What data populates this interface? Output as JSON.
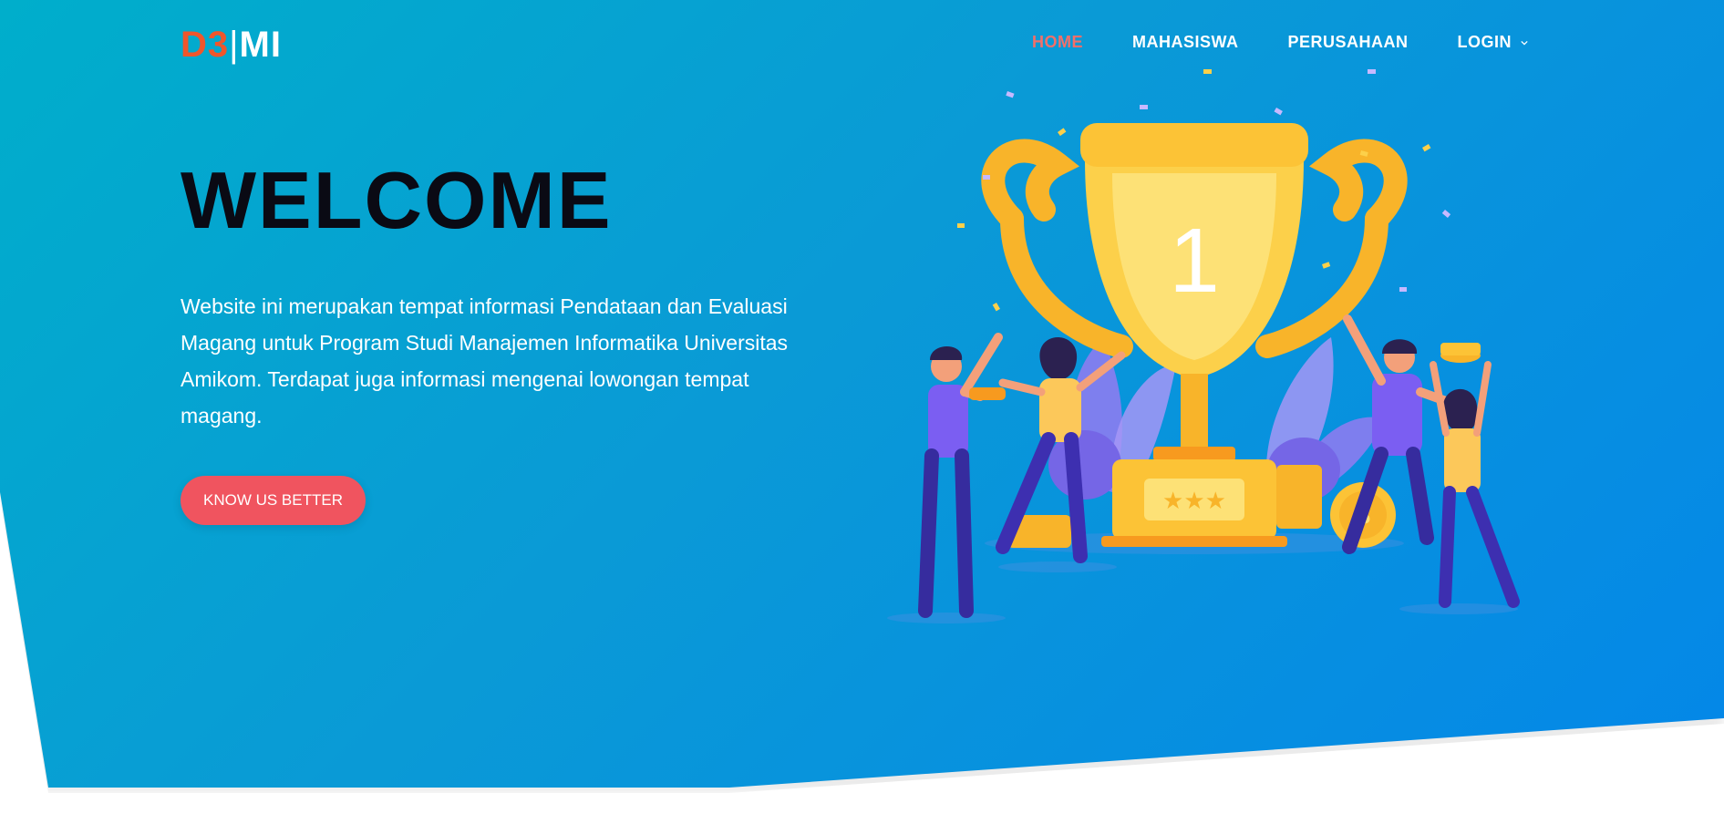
{
  "brand": {
    "part_a": "D3",
    "separator": "|",
    "part_b": "MI"
  },
  "nav": {
    "items": [
      {
        "label": "HOME",
        "active": true
      },
      {
        "label": "MAHASISWA",
        "active": false
      },
      {
        "label": "PERUSAHAAN",
        "active": false
      },
      {
        "label": "LOGIN",
        "active": false,
        "dropdown": true
      }
    ]
  },
  "hero": {
    "title": "WELCOME",
    "description": "Website ini merupakan tempat informasi Pendataan dan Evaluasi Magang untuk Program Studi Manajemen Informatika Universitas Amikom. Terdapat juga informasi mengenai lowongan tempat magang.",
    "cta_label": "KNOW US BETTER",
    "illustration": {
      "trophy_number": "1"
    }
  },
  "colors": {
    "brand_accent": "#f0562b",
    "nav_active": "#f36f6a",
    "cta": "#f0545f",
    "hero_gradient_start": "#00aecb",
    "hero_gradient_end": "#0487e8",
    "title": "#0a0a14"
  },
  "icons": [
    "chevron-down-icon",
    "trophy-illustration"
  ]
}
